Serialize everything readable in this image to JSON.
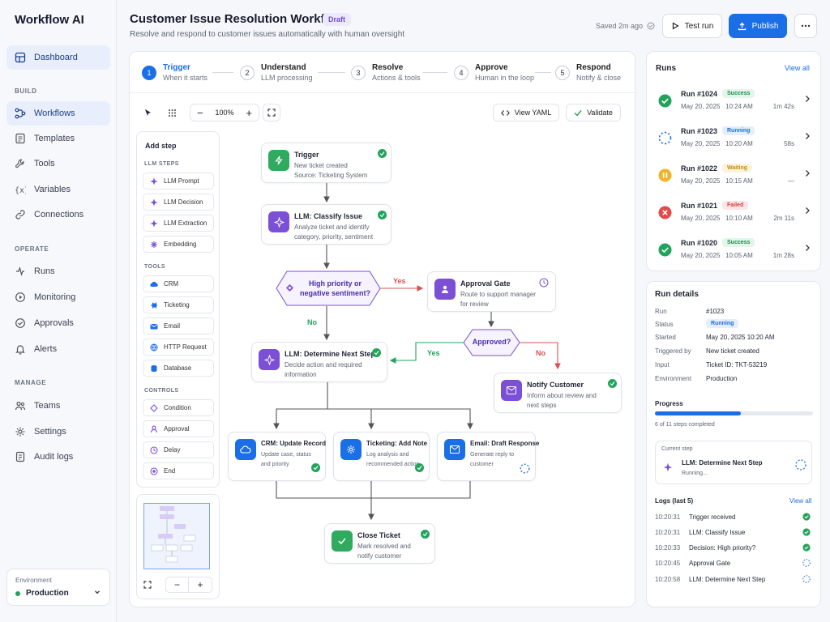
{
  "app": {
    "name": "Workflow AI"
  },
  "sidebar": {
    "dashboard": "Dashboard",
    "build_label": "BUILD",
    "build": [
      "Workflows",
      "Templates",
      "Tools",
      "Variables",
      "Connections"
    ],
    "operate_label": "OPERATE",
    "operate": [
      "Runs",
      "Monitoring",
      "Approvals",
      "Alerts"
    ],
    "manage_label": "MANAGE",
    "manage": [
      "Teams",
      "Settings",
      "Audit logs"
    ],
    "environment": {
      "label": "Environment",
      "value": "Production"
    }
  },
  "header": {
    "title": "Customer Issue Resolution Workflow",
    "badge": "Draft",
    "subtitle": "Resolve and respond to customer issues automatically with human oversight",
    "saved": "Saved 2m ago",
    "test_run": "Test run",
    "publish": "Publish"
  },
  "steps": [
    {
      "num": "1",
      "title": "Trigger",
      "sub": "When it starts"
    },
    {
      "num": "2",
      "title": "Understand",
      "sub": "LLM processing"
    },
    {
      "num": "3",
      "title": "Resolve",
      "sub": "Actions & tools"
    },
    {
      "num": "4",
      "title": "Approve",
      "sub": "Human in the loop"
    },
    {
      "num": "5",
      "title": "Respond",
      "sub": "Notify & close"
    }
  ],
  "toolbar": {
    "zoom": "100%",
    "view_yaml": "View YAML",
    "validate": "Validate"
  },
  "add_step": {
    "title": "Add step",
    "llm_label": "LLM STEPS",
    "llm": [
      "LLM Prompt",
      "LLM Decision",
      "LLM Extraction",
      "Embedding"
    ],
    "tools_label": "TOOLS",
    "tools": [
      "CRM",
      "Ticketing",
      "Email",
      "HTTP Request",
      "Database"
    ],
    "controls_label": "CONTROLS",
    "controls": [
      "Condition",
      "Approval",
      "Delay",
      "End"
    ]
  },
  "nodes": {
    "trigger": {
      "title": "Trigger",
      "desc": "New ticket created\nSource: Ticketing System"
    },
    "classify": {
      "title": "LLM: Classify Issue",
      "desc": "Analyze ticket and identify\ncategory, priority, sentiment"
    },
    "decision": {
      "title": "High priority or\nnegative sentiment?"
    },
    "approval": {
      "title": "Approval Gate",
      "desc": "Route to support manager\nfor review"
    },
    "approved": {
      "title": "Approved?"
    },
    "next_step": {
      "title": "LLM: Determine Next Step",
      "desc": "Decide action and required\ninformation"
    },
    "notify": {
      "title": "Notify Customer",
      "desc": "Inform about review and\nnext steps"
    },
    "crm": {
      "title": "CRM: Update Record",
      "desc": "Update case, status\nand priority"
    },
    "ticketing": {
      "title": "Ticketing: Add Note",
      "desc": "Log analysis and\nrecommended action"
    },
    "email": {
      "title": "Email: Draft Response",
      "desc": "Generate reply to\ncustomer"
    },
    "close": {
      "title": "Close Ticket",
      "desc": "Mark resolved and\nnotify customer"
    }
  },
  "edges": {
    "yes": "Yes",
    "no": "No"
  },
  "runs": {
    "title": "Runs",
    "view_all": "View all",
    "items": [
      {
        "name": "Run #1024",
        "status": "Success",
        "date": "May 20, 2025",
        "time": "10:24 AM",
        "duration": "1m 42s"
      },
      {
        "name": "Run #1023",
        "status": "Running",
        "date": "May 20, 2025",
        "time": "10:20 AM",
        "duration": "58s"
      },
      {
        "name": "Run #1022",
        "status": "Waiting",
        "date": "May 20, 2025",
        "time": "10:15 AM",
        "duration": "—"
      },
      {
        "name": "Run #1021",
        "status": "Failed",
        "date": "May 20, 2025",
        "time": "10:10 AM",
        "duration": "2m 11s"
      },
      {
        "name": "Run #1020",
        "status": "Success",
        "date": "May 20, 2025",
        "time": "10:05 AM",
        "duration": "1m 28s"
      }
    ]
  },
  "details": {
    "title": "Run details",
    "fields": [
      {
        "k": "Run",
        "v": "#1023"
      },
      {
        "k": "Status",
        "v": "Running"
      },
      {
        "k": "Started",
        "v": "May 20, 2025 10:20 AM"
      },
      {
        "k": "Triggered by",
        "v": "New ticket created"
      },
      {
        "k": "Input",
        "v": "Ticket ID: TKT-53219"
      },
      {
        "k": "Environment",
        "v": "Production"
      }
    ],
    "progress_label": "Progress",
    "progress_fraction": 0.545,
    "progress_text": "6 of 11 steps completed",
    "current_label": "Current step",
    "current_step": "LLM: Determine Next Step",
    "current_status": "Running...",
    "logs_label": "Logs (last 5)",
    "logs_view_all": "View all",
    "logs": [
      {
        "t": "10:20:31",
        "m": "Trigger received",
        "done": true
      },
      {
        "t": "10:20:31",
        "m": "LLM: Classify Issue",
        "done": true
      },
      {
        "t": "10:20:33",
        "m": "Decision: High priority?",
        "done": true
      },
      {
        "t": "10:20:45",
        "m": "Approval Gate",
        "done": false
      },
      {
        "t": "10:20:58",
        "m": "LLM: Determine Next Step",
        "done": false
      }
    ]
  },
  "colors": {
    "accent": "#1a6ee6",
    "success": "#22a35b",
    "warning": "#f0b429",
    "danger": "#e04b4b",
    "purple": "#7b4fd6"
  }
}
